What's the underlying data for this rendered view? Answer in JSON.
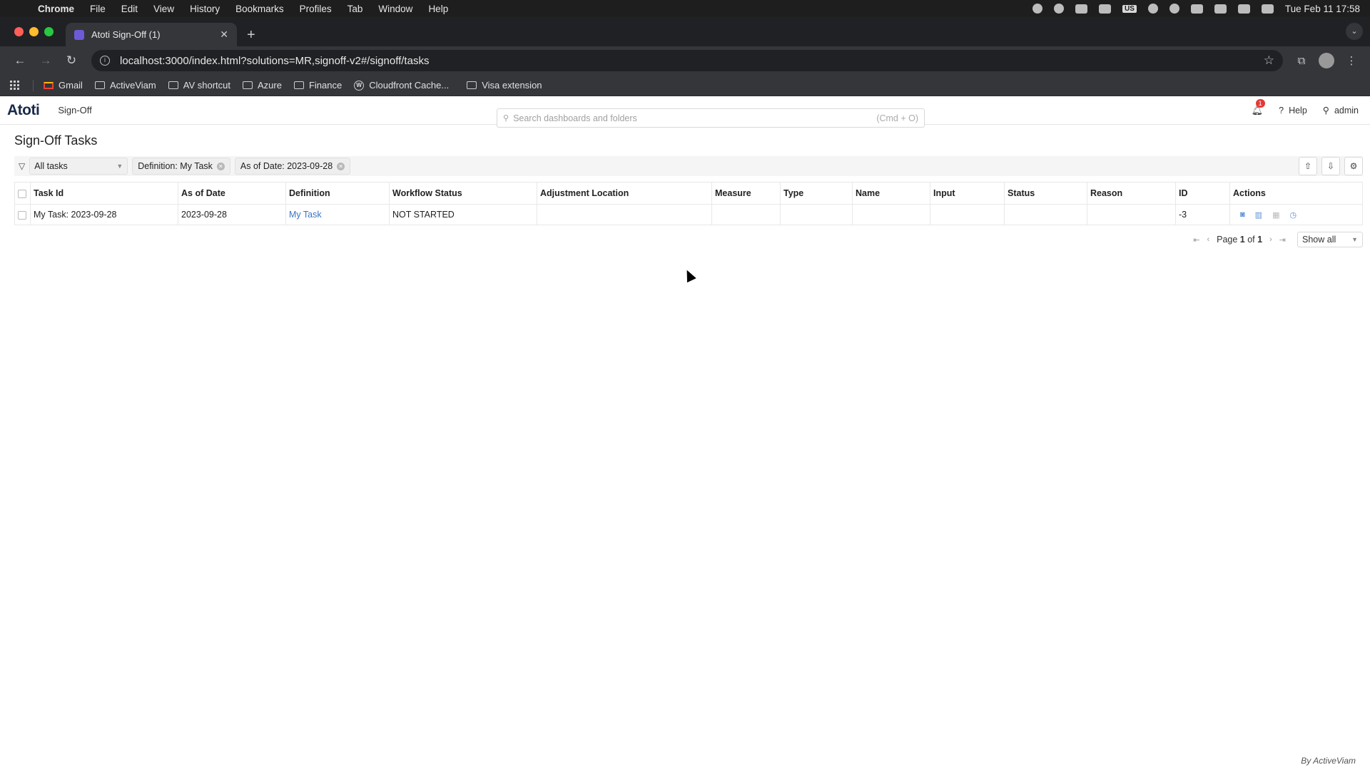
{
  "menubar": {
    "app": "Chrome",
    "items": [
      "File",
      "Edit",
      "View",
      "History",
      "Bookmarks",
      "Profiles",
      "Tab",
      "Window",
      "Help"
    ],
    "keyboard": "US",
    "clock": "Tue Feb 11  17:58"
  },
  "browser": {
    "tab_title": "Atoti Sign-Off (1)",
    "url": "localhost:3000/index.html?solutions=MR,signoff-v2#/signoff/tasks",
    "bookmarks": [
      "Gmail",
      "ActiveViam",
      "AV shortcut",
      "Azure",
      "Finance",
      "Cloudfront Cache...",
      "Visa extension"
    ]
  },
  "app": {
    "logo": "Atoti",
    "name": "Sign-Off",
    "search_placeholder": "Search dashboards and folders",
    "search_shortcut": "(Cmd + O)",
    "notification_count": "1",
    "help": "Help",
    "user": "admin"
  },
  "page": {
    "title": "Sign-Off Tasks",
    "filter_select": "All tasks",
    "chips": [
      "Definition: My Task",
      "As of Date: 2023-09-28"
    ]
  },
  "table": {
    "headers": [
      "Task Id",
      "As of Date",
      "Definition",
      "Workflow Status",
      "Adjustment Location",
      "Measure",
      "Type",
      "Name",
      "Input",
      "Status",
      "Reason",
      "ID",
      "Actions"
    ],
    "rows": [
      {
        "task_id": "My Task: 2023-09-28",
        "as_of_date": "2023-09-28",
        "definition": "My Task",
        "workflow_status": "NOT STARTED",
        "adjustment_location": "",
        "measure": "",
        "type": "",
        "name": "",
        "input": "",
        "status": "",
        "reason": "",
        "id": "-3"
      }
    ]
  },
  "pager": {
    "page_label": "Page",
    "current": "1",
    "of_label": "of",
    "total": "1",
    "page_size": "Show all"
  },
  "footer": "By ActiveViam"
}
